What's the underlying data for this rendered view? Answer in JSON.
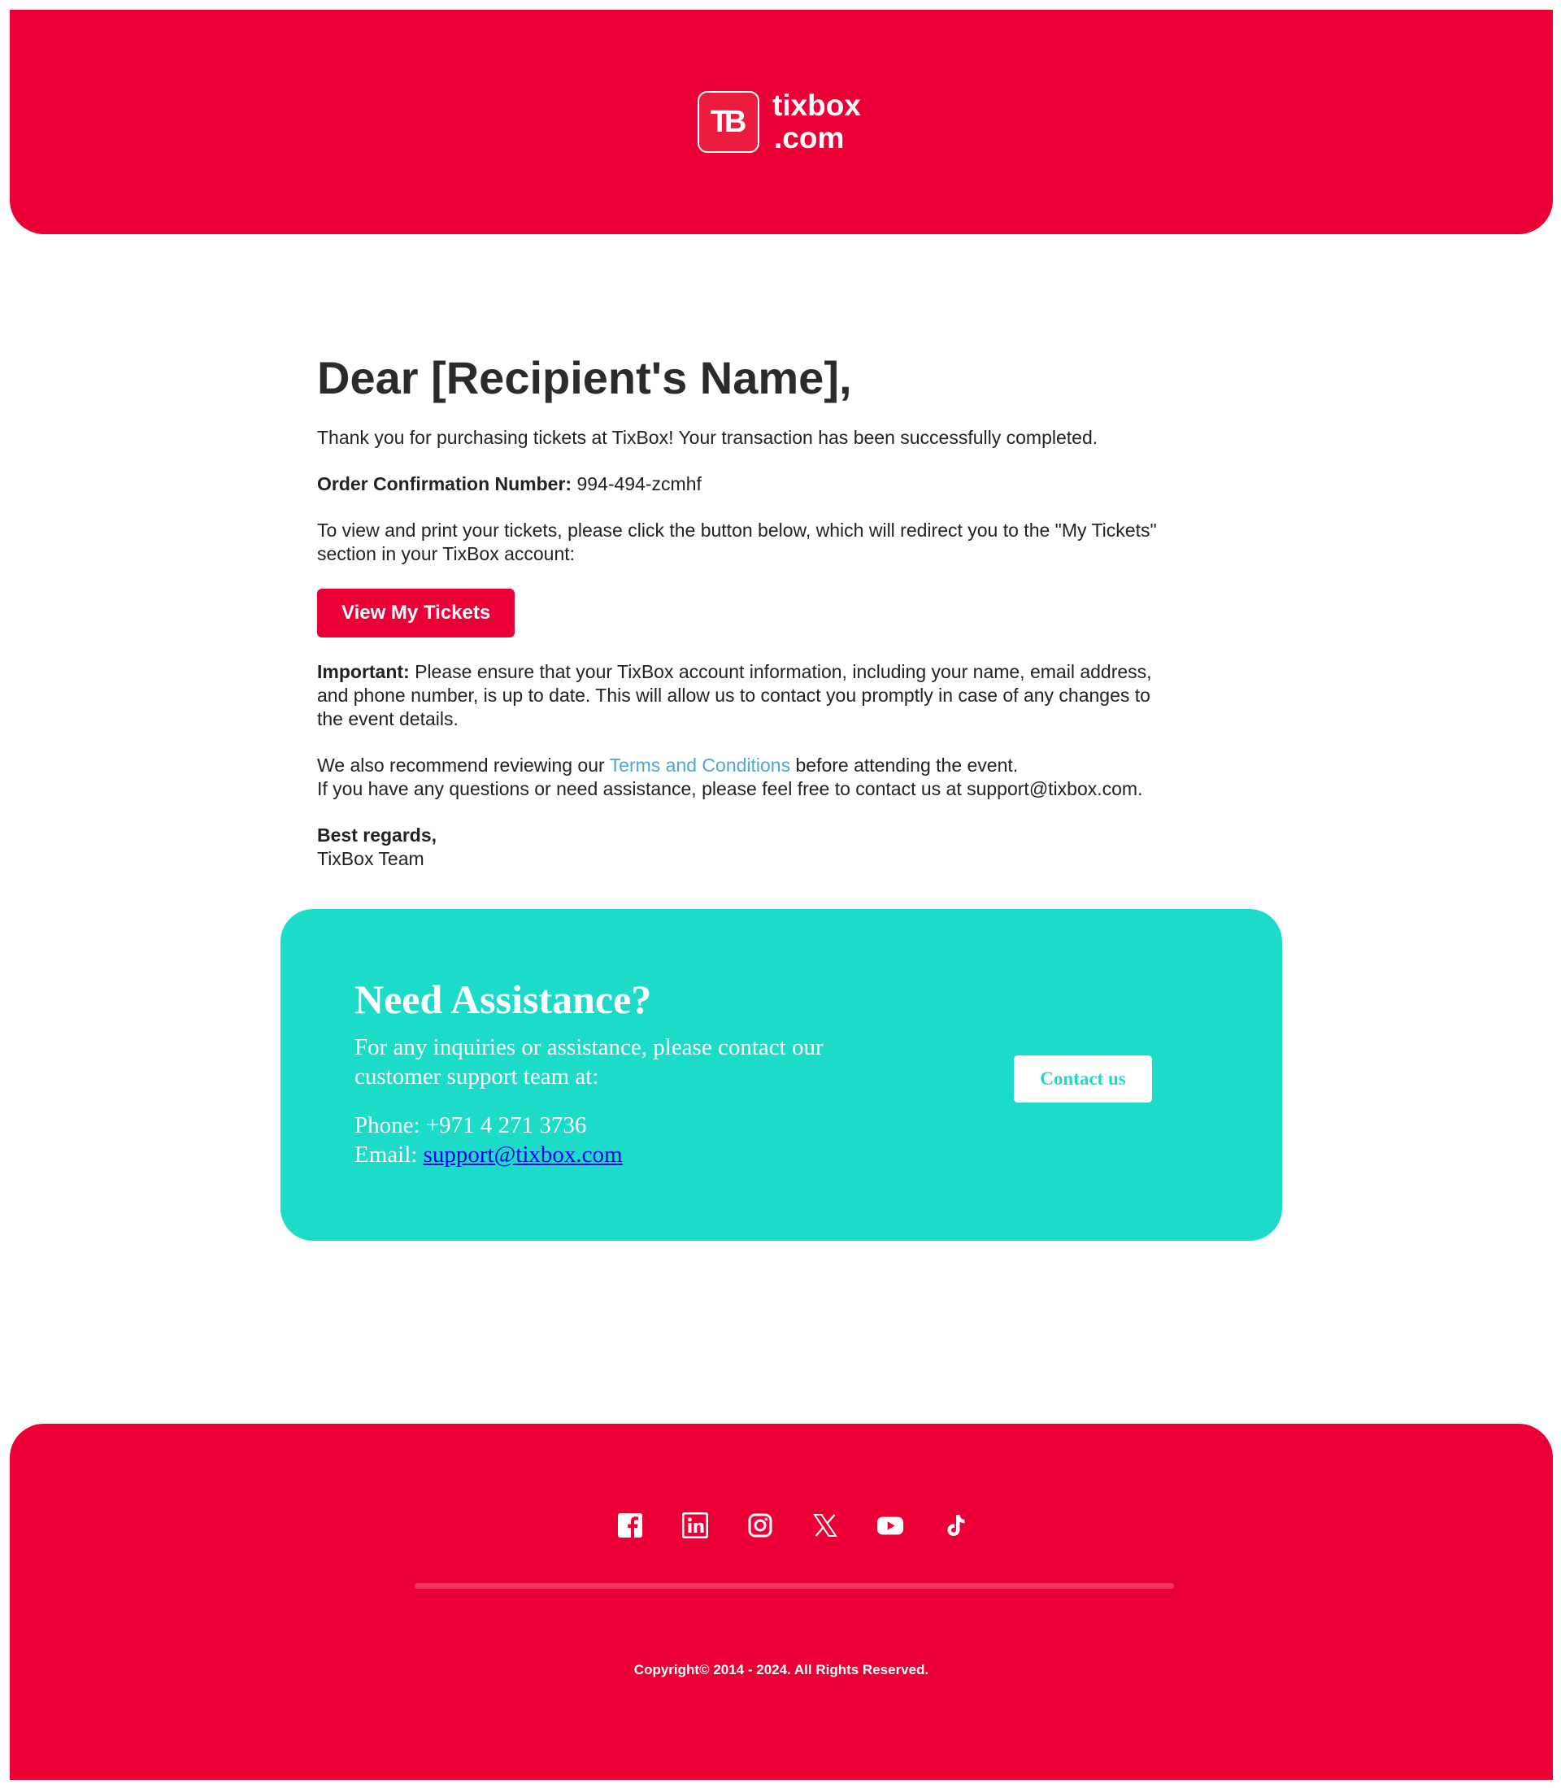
{
  "header": {
    "logo_mark": "TB",
    "logo_line1": "tixbox",
    "logo_line2": ".com"
  },
  "letter": {
    "greeting": "Dear [Recipient's Name],",
    "thanks": "Thank you for purchasing tickets at TixBox! Your transaction has been successfully completed.",
    "order_label": "Order Confirmation Number:",
    "order_number": "994-494-zcmhf",
    "view_instructions": "To view and print your tickets, please click the button below, which will redirect you to the \"My Tickets\" section in your TixBox account:",
    "cta_label": "View My Tickets",
    "important_label": "Important:",
    "important_text": "Please ensure that your TixBox account information, including your name, email address, and phone number, is up to date. This will allow us to contact you promptly in case of any changes to the event details.",
    "recommend_before": "We also recommend reviewing our",
    "terms_link": "Terms and Conditions",
    "recommend_after": "before attending the event.",
    "questions": "If you have any questions or need assistance, please feel free to contact us at support@tixbox.com.",
    "regards": "Best regards,",
    "team": "TixBox Team"
  },
  "assist": {
    "title": "Need Assistance?",
    "body": "For any inquiries or assistance, please contact our customer support team at:",
    "phone": "Phone: +971 4 271 3736",
    "email_label": "Email:",
    "email": "support@tixbox.com",
    "button": "Contact us"
  },
  "footer": {
    "socials": [
      "facebook-icon",
      "linkedin-icon",
      "instagram-icon",
      "x-icon",
      "youtube-icon",
      "tiktok-icon"
    ],
    "copyright": "Copyright© 2014 - 2024. All Rights Reserved."
  },
  "colors": {
    "brand": "#eb0036",
    "assist_bg": "#1ddbc9",
    "link": "#4fa6d8"
  }
}
